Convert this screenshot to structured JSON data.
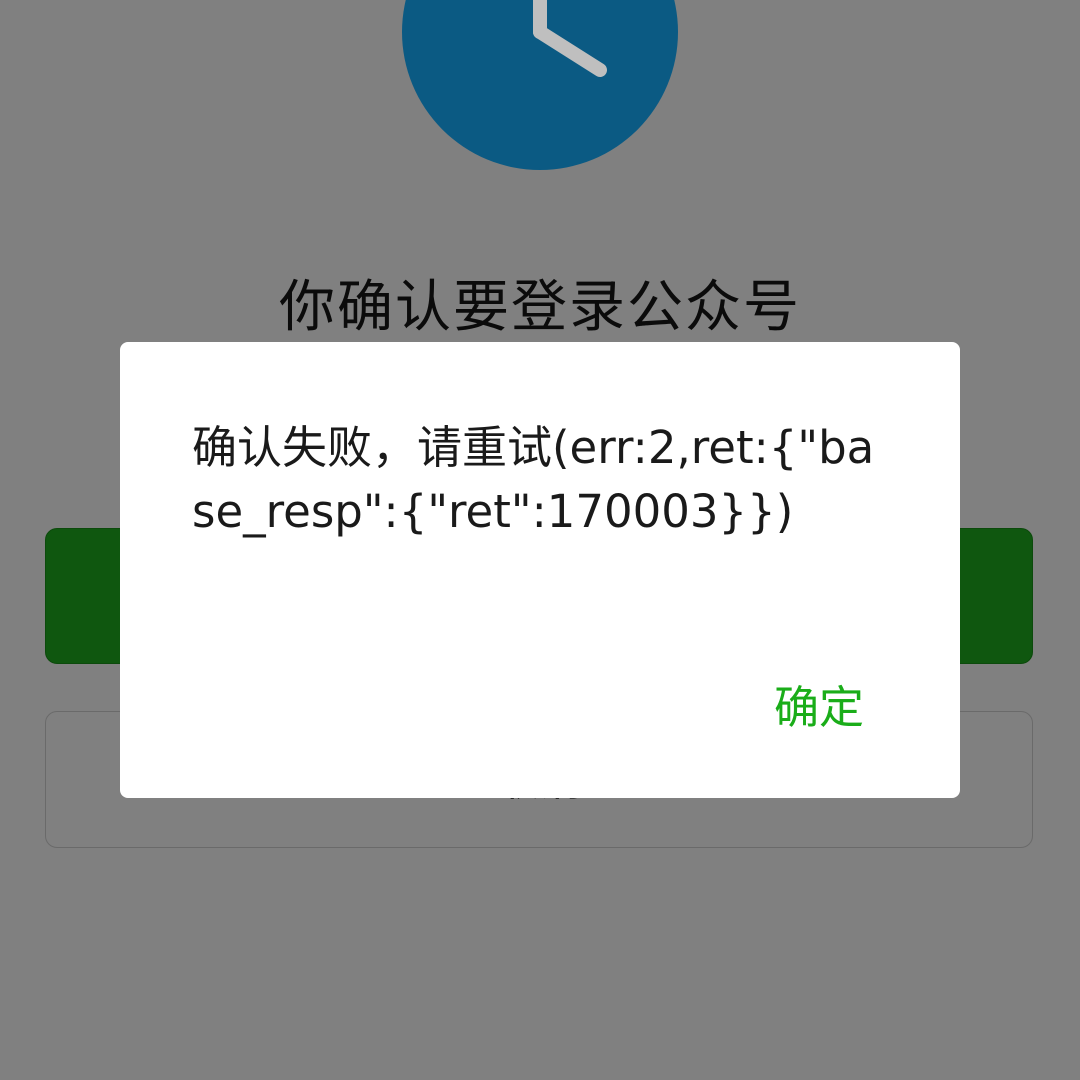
{
  "page": {
    "title": "你确认要登录公众号",
    "secondary_button_label": "取消"
  },
  "icons": {
    "header": "clock-icon"
  },
  "colors": {
    "overlay_background": "#808080",
    "clock_blue": "#0b5a83",
    "primary_button": "#0f570f",
    "dialog_background": "#ffffff",
    "confirm_text": "#1aad19"
  },
  "dialog": {
    "message": "确认失败，请重试(err:2,ret:{\"base_resp\":{\"ret\":170003}})",
    "confirm_label": "确定"
  }
}
